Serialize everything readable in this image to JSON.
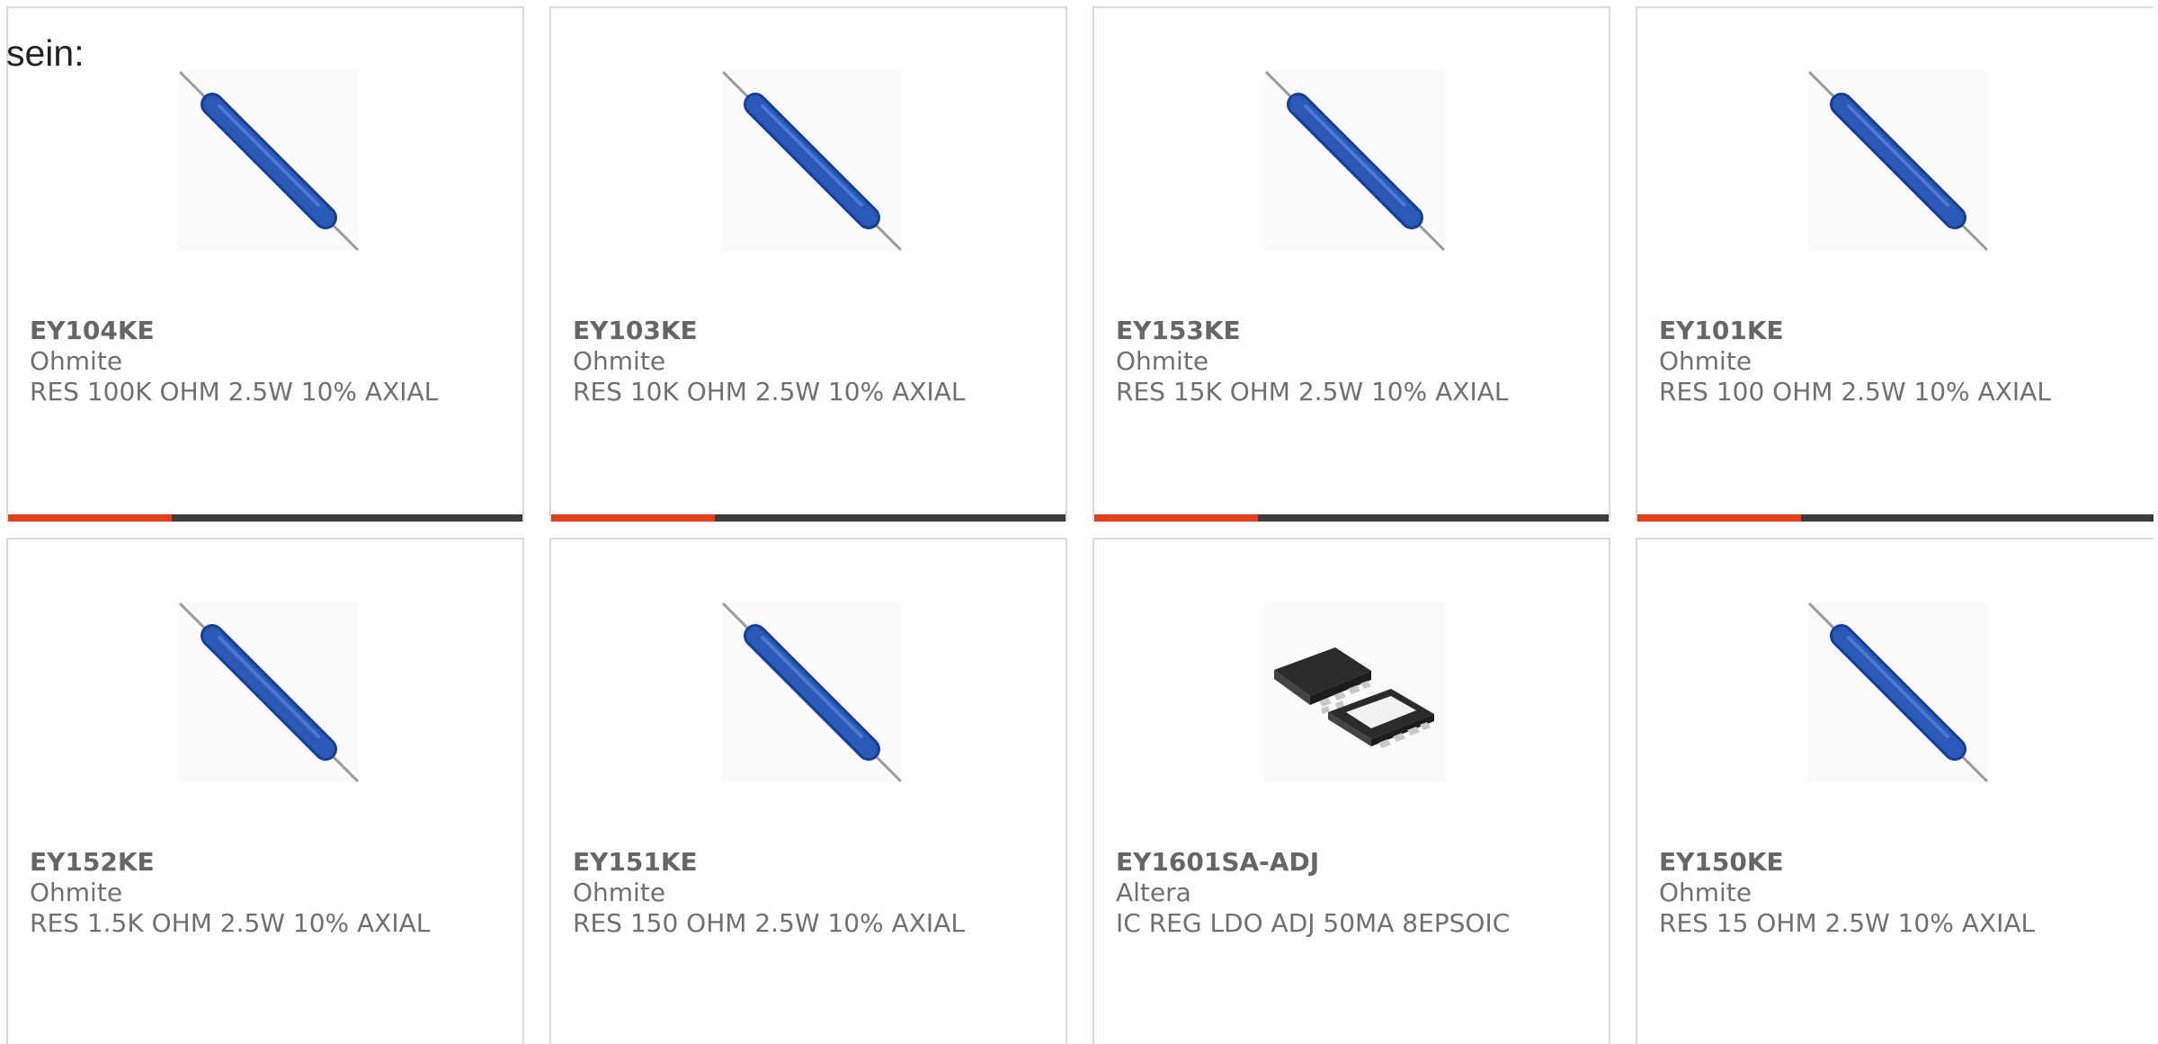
{
  "header_fragment": "sein:",
  "colors": {
    "accent": "#e2401c",
    "bar_base": "#3d3d3d",
    "resistor_body": "#2a59b8",
    "chip_body": "#333333"
  },
  "products": [
    {
      "part": "EY104KE",
      "manufacturer": "Ohmite",
      "description": "RES 100K OHM 2.5W 10% AXIAL",
      "image_icon": "axial-resistor-icon"
    },
    {
      "part": "EY103KE",
      "manufacturer": "Ohmite",
      "description": "RES 10K OHM 2.5W 10% AXIAL",
      "image_icon": "axial-resistor-icon"
    },
    {
      "part": "EY153KE",
      "manufacturer": "Ohmite",
      "description": "RES 15K OHM 2.5W 10% AXIAL",
      "image_icon": "axial-resistor-icon"
    },
    {
      "part": "EY101KE",
      "manufacturer": "Ohmite",
      "description": "RES 100 OHM 2.5W 10% AXIAL",
      "image_icon": "axial-resistor-icon"
    },
    {
      "part": "EY152KE",
      "manufacturer": "Ohmite",
      "description": "RES 1.5K OHM 2.5W 10% AXIAL",
      "image_icon": "axial-resistor-icon"
    },
    {
      "part": "EY151KE",
      "manufacturer": "Ohmite",
      "description": "RES 150 OHM 2.5W 10% AXIAL",
      "image_icon": "axial-resistor-icon"
    },
    {
      "part": "EY1601SA-ADJ",
      "manufacturer": "Altera",
      "description": "IC REG LDO ADJ 50MA 8EPSOIC",
      "image_icon": "ic-chip-icon"
    },
    {
      "part": "EY150KE",
      "manufacturer": "Ohmite",
      "description": "RES 15 OHM 2.5W 10% AXIAL",
      "image_icon": "axial-resistor-icon"
    }
  ]
}
